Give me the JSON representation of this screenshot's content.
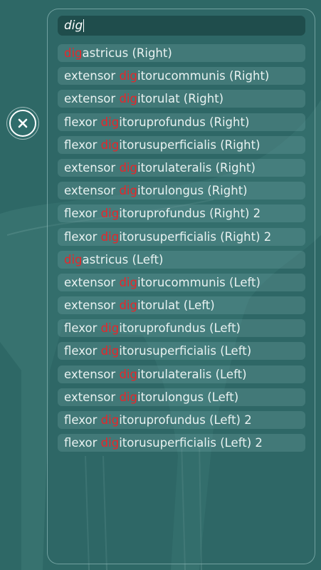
{
  "search": {
    "query": "dig"
  },
  "results": [
    {
      "pre": "",
      "match": "dig",
      "post": "astricus (Right)"
    },
    {
      "pre": "extensor ",
      "match": "dig",
      "post": "itorucommunis (Right)"
    },
    {
      "pre": "extensor ",
      "match": "dig",
      "post": "itorulat (Right)"
    },
    {
      "pre": "flexor ",
      "match": "dig",
      "post": "itoruprofundus (Right)"
    },
    {
      "pre": "flexor ",
      "match": "dig",
      "post": "itorusuperficialis (Right)"
    },
    {
      "pre": "extensor ",
      "match": "dig",
      "post": "itorulateralis (Right)"
    },
    {
      "pre": "extensor ",
      "match": "dig",
      "post": "itorulongus (Right)"
    },
    {
      "pre": "flexor ",
      "match": "dig",
      "post": "itoruprofundus (Right) 2"
    },
    {
      "pre": "flexor ",
      "match": "dig",
      "post": "itorusuperficialis (Right) 2"
    },
    {
      "pre": "",
      "match": "dig",
      "post": "astricus (Left)"
    },
    {
      "pre": "extensor ",
      "match": "dig",
      "post": "itorucommunis (Left)"
    },
    {
      "pre": "extensor ",
      "match": "dig",
      "post": "itorulat (Left)"
    },
    {
      "pre": "flexor ",
      "match": "dig",
      "post": "itoruprofundus (Left)"
    },
    {
      "pre": "flexor ",
      "match": "dig",
      "post": "itorusuperficialis (Left)"
    },
    {
      "pre": "extensor ",
      "match": "dig",
      "post": "itorulateralis (Left)"
    },
    {
      "pre": "extensor ",
      "match": "dig",
      "post": "itorulongus (Left)"
    },
    {
      "pre": "flexor ",
      "match": "dig",
      "post": "itoruprofundus (Left) 2"
    },
    {
      "pre": "flexor ",
      "match": "dig",
      "post": "itorusuperficialis (Left) 2"
    }
  ],
  "colors": {
    "background": "#2e6866",
    "highlight": "#e8262a",
    "search_bg": "#1f4d4c"
  },
  "icons": {
    "close": "close-icon"
  }
}
